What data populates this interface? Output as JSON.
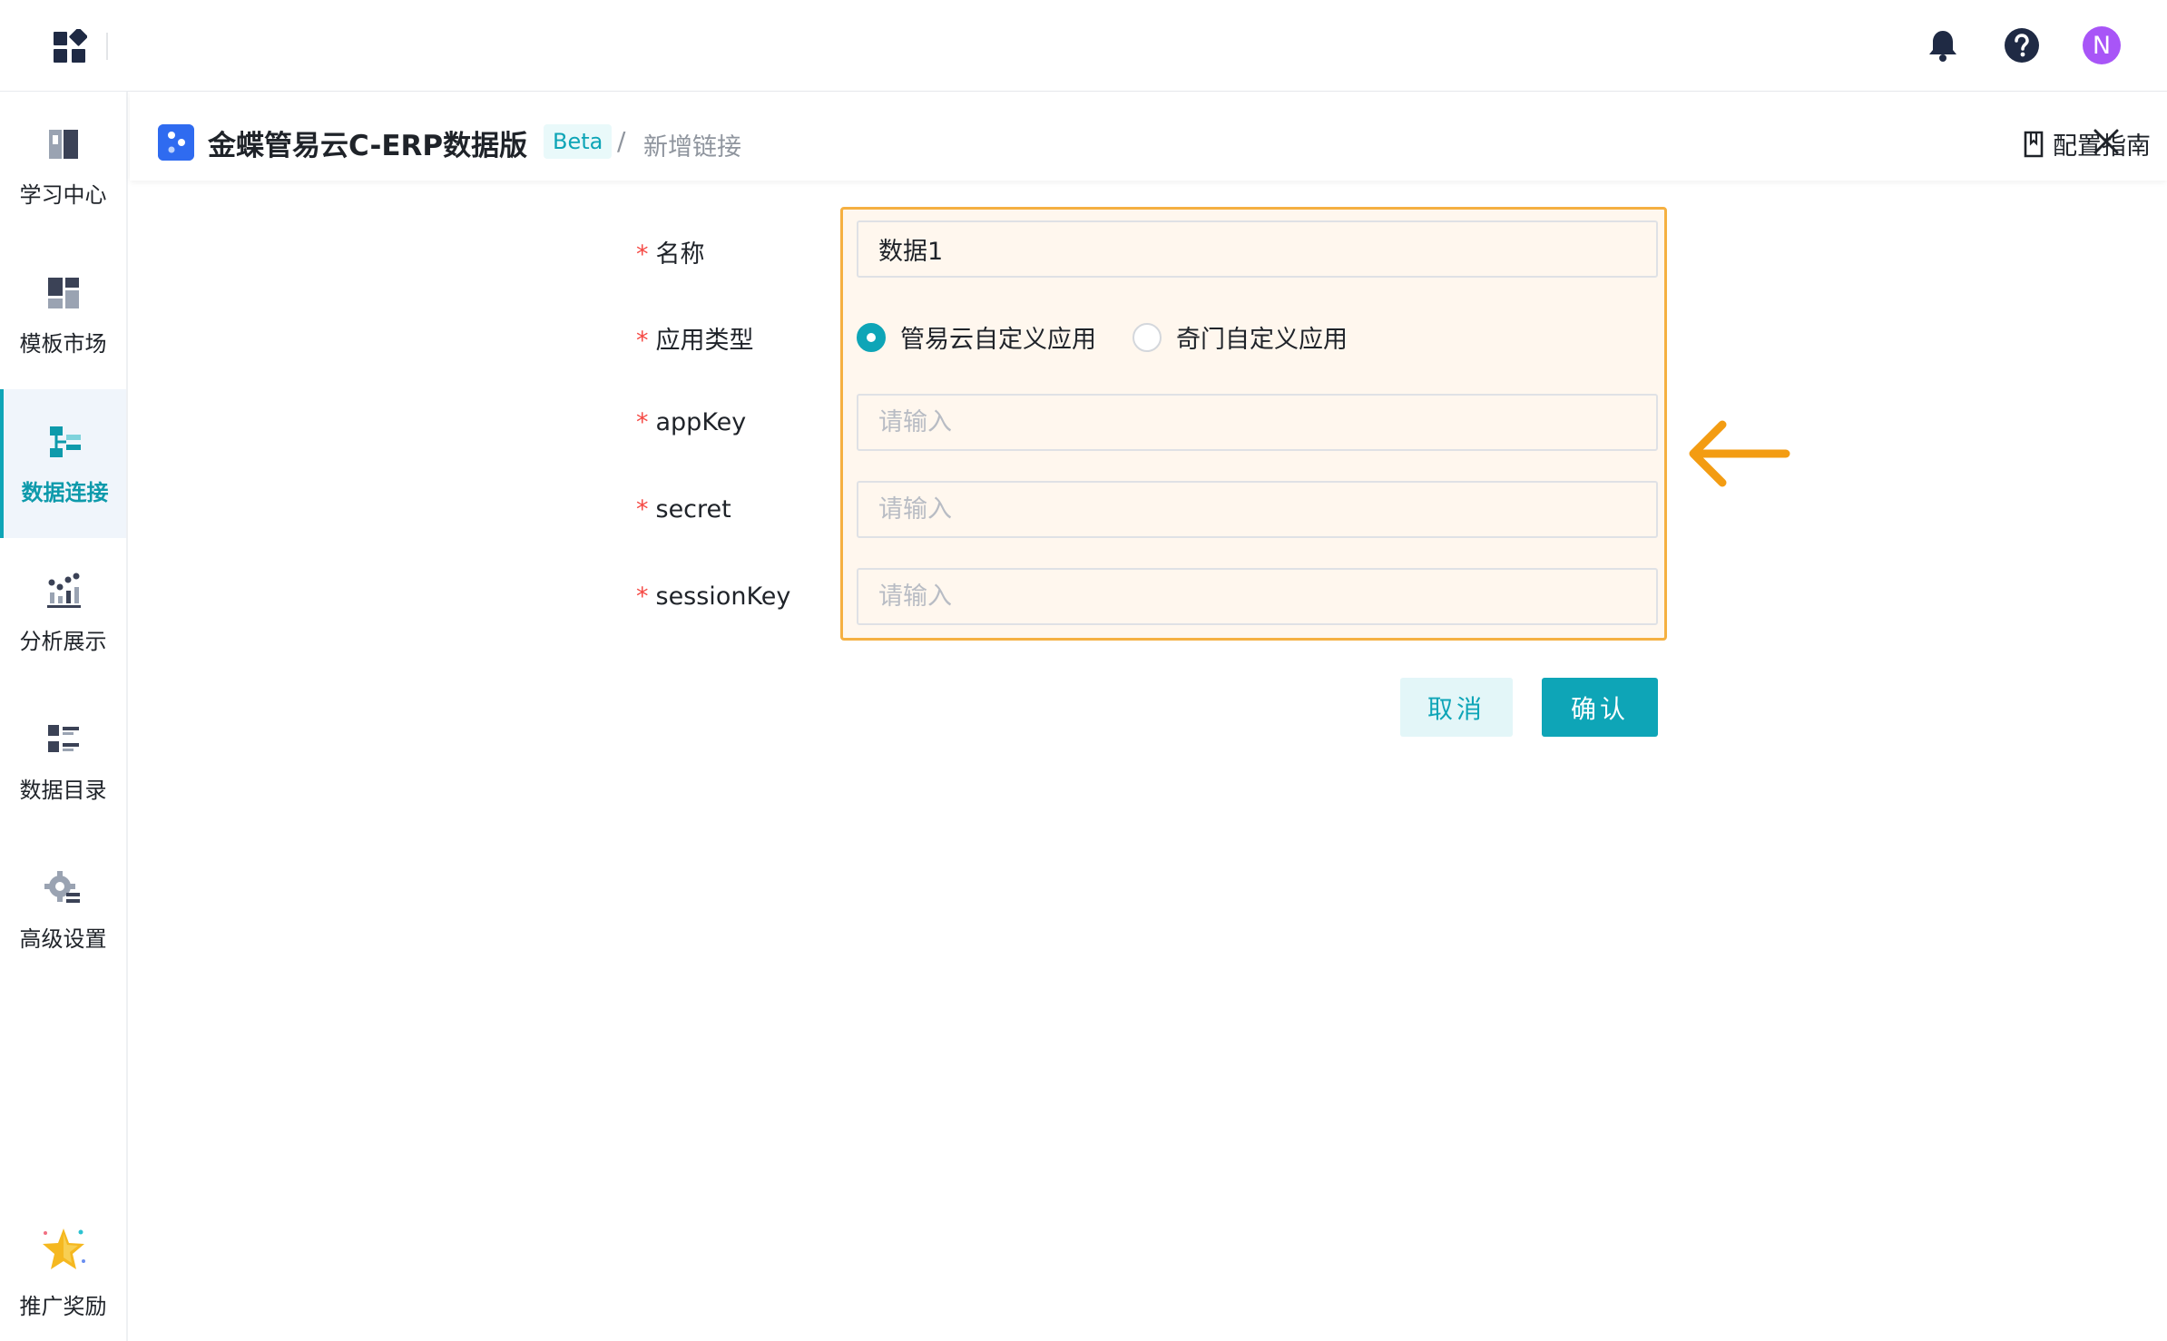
{
  "header": {
    "title": "金蝶管易云C-ERP数据版",
    "badge": "Beta",
    "separator": "/",
    "breadcrumb": "新增链接",
    "guide_label": "配置指南"
  },
  "avatar": {
    "initial": "N",
    "color": "#a855f7"
  },
  "sidebar": {
    "items": [
      {
        "label": "学习中心",
        "icon": "book-icon",
        "active": false
      },
      {
        "label": "模板市场",
        "icon": "template-grid-icon",
        "active": false
      },
      {
        "label": "数据连接",
        "icon": "data-connection-icon",
        "active": true
      },
      {
        "label": "分析展示",
        "icon": "analytics-chart-icon",
        "active": false
      },
      {
        "label": "数据目录",
        "icon": "catalog-list-icon",
        "active": false
      },
      {
        "label": "高级设置",
        "icon": "settings-gear-icon",
        "active": false
      }
    ],
    "promo": {
      "label": "推广奖励",
      "icon": "star-reward-icon"
    }
  },
  "form": {
    "name": {
      "label": "名称",
      "value": "数据1"
    },
    "app_type": {
      "label": "应用类型",
      "options": [
        "管易云自定义应用",
        "奇门自定义应用"
      ],
      "selected": "管易云自定义应用"
    },
    "appkey": {
      "label": "appKey",
      "placeholder": "请输入"
    },
    "secret": {
      "label": "secret",
      "placeholder": "请输入"
    },
    "sessionkey": {
      "label": "sessionKey",
      "placeholder": "请输入"
    },
    "required_mark": "*"
  },
  "buttons": {
    "cancel": "取消",
    "confirm": "确认"
  },
  "colors": {
    "accent": "#0ea5b7",
    "highlight_border": "#f5b041",
    "highlight_bg": "#fff7ee",
    "arrow": "#f39c12",
    "logo": "#2f6bf0"
  }
}
